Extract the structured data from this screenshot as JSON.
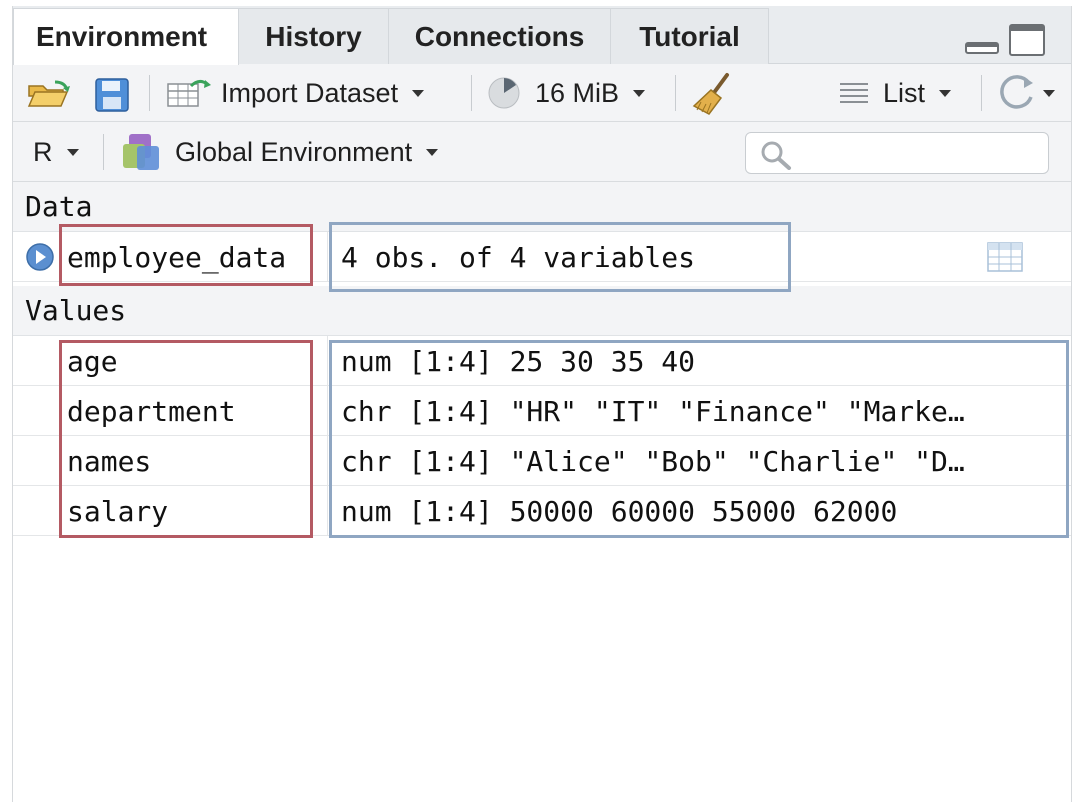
{
  "tabs": [
    "Environment",
    "History",
    "Connections",
    "Tutorial"
  ],
  "toolbar": {
    "import_label": "Import Dataset",
    "memory_label": "16 MiB",
    "view_label": "List"
  },
  "toolbar2": {
    "language": "R",
    "environment": "Global Environment",
    "search_placeholder": ""
  },
  "sections": {
    "data": "Data",
    "values": "Values"
  },
  "data_rows": [
    {
      "name": "employee_data",
      "value": "4 obs. of 4 variables"
    }
  ],
  "value_rows": [
    {
      "name": "age",
      "value": "num [1:4] 25 30 35 40"
    },
    {
      "name": "department",
      "value": "chr [1:4] \"HR\" \"IT\" \"Finance\" \"Marke…"
    },
    {
      "name": "names",
      "value": "chr [1:4] \"Alice\" \"Bob\" \"Charlie\" \"D…"
    },
    {
      "name": "salary",
      "value": "num [1:4] 50000 60000 55000 62000"
    }
  ],
  "colors": {
    "highlight_name": "#b45a63",
    "highlight_value": "#8fa6c2",
    "expand_icon": "#5b8fd0"
  },
  "icons": [
    "open-folder-icon",
    "save-icon",
    "import-dataset-icon",
    "memory-pie-icon",
    "broom-icon",
    "list-lines-icon",
    "refresh-icon",
    "environment-icon",
    "search-icon",
    "expand-icon",
    "table-grid-icon",
    "minimize-icon",
    "maximize-icon"
  ]
}
